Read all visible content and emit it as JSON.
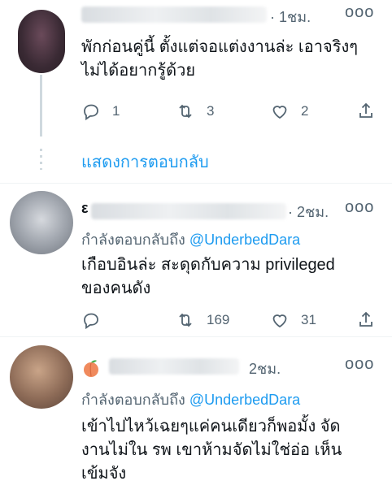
{
  "tweets": [
    {
      "time": "· 1ชม.",
      "more": "ooo",
      "text_lines": [
        "พักก่อนคู่นี้ ตั้งแต่จอแต่งงานล่ะ เอาจริงๆ",
        "ไม่ได้อยากรู้ด้วย"
      ],
      "stats": {
        "replies": "1",
        "retweets": "3",
        "likes": "2"
      }
    },
    {
      "prefix": "ε",
      "time": "· 2ชม.",
      "more": "ooo",
      "reply_label": "กำลังตอบกลับถึง",
      "reply_handle": "@UnderbedDara",
      "text_lines": [
        "เกือบอินล่ะ สะดุดกับความ privileged",
        "ของคนดัง"
      ],
      "stats": {
        "replies": "",
        "retweets": "169",
        "likes": "31"
      }
    },
    {
      "time": "2ชม.",
      "more": "ooo",
      "reply_label": "กำลังตอบกลับถึง",
      "reply_handle": "@UnderbedDara",
      "text_lines": [
        "เข้าไปไหว้เฉยๆแค่คนเดียวก็พอมั้ง จัด",
        "งานไม่ใน รพ เขาห้ามจัดไม่ใช่อ่อ เห็น",
        "เข้มจัง"
      ]
    }
  ],
  "show_replies": "แสดงการตอบกลับ",
  "colors": {
    "accent": "#1d9bf0",
    "muted": "#536471",
    "text": "#0f1419"
  },
  "icons": [
    "reply-icon",
    "retweet-icon",
    "like-icon",
    "share-icon",
    "more-icon",
    "peach-emoji-icon"
  ]
}
